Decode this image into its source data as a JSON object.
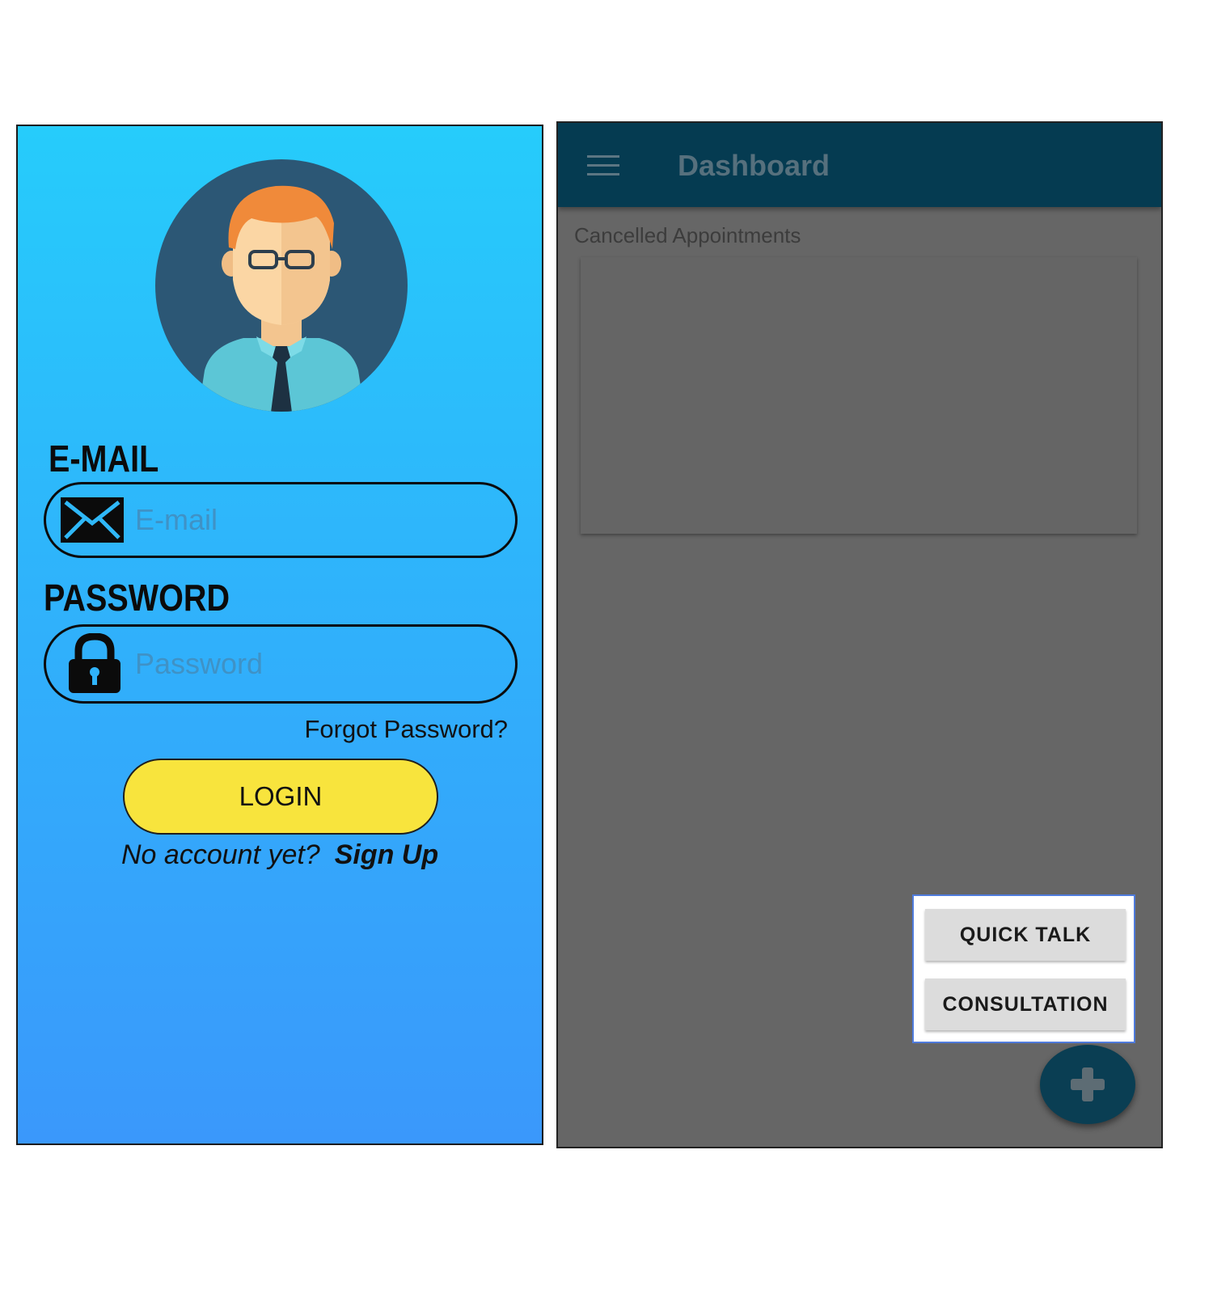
{
  "login": {
    "email_label": "E-MAIL",
    "email_placeholder": "E-mail",
    "password_label": "PASSWORD",
    "password_placeholder": "Password",
    "forgot_password": "Forgot Password?",
    "login_button": "LOGIN",
    "no_account_text": "No account yet?",
    "signup_link": "Sign Up",
    "icons": {
      "avatar": "user-avatar-icon",
      "email": "envelope-icon",
      "password": "lock-icon"
    },
    "colors": {
      "background_top": "#26ccfb",
      "background_bottom": "#3a98fb",
      "button": "#f8e43d"
    }
  },
  "dashboard": {
    "title": "Dashboard",
    "section_title": "Cancelled Appointments",
    "speed_dial": {
      "items": [
        "QUICK TALK",
        "CONSULTATION"
      ]
    },
    "icons": {
      "menu": "hamburger-menu-icon",
      "fab": "plus-icon"
    },
    "colors": {
      "appbar": "#053b51",
      "overlay": "#666666"
    }
  }
}
